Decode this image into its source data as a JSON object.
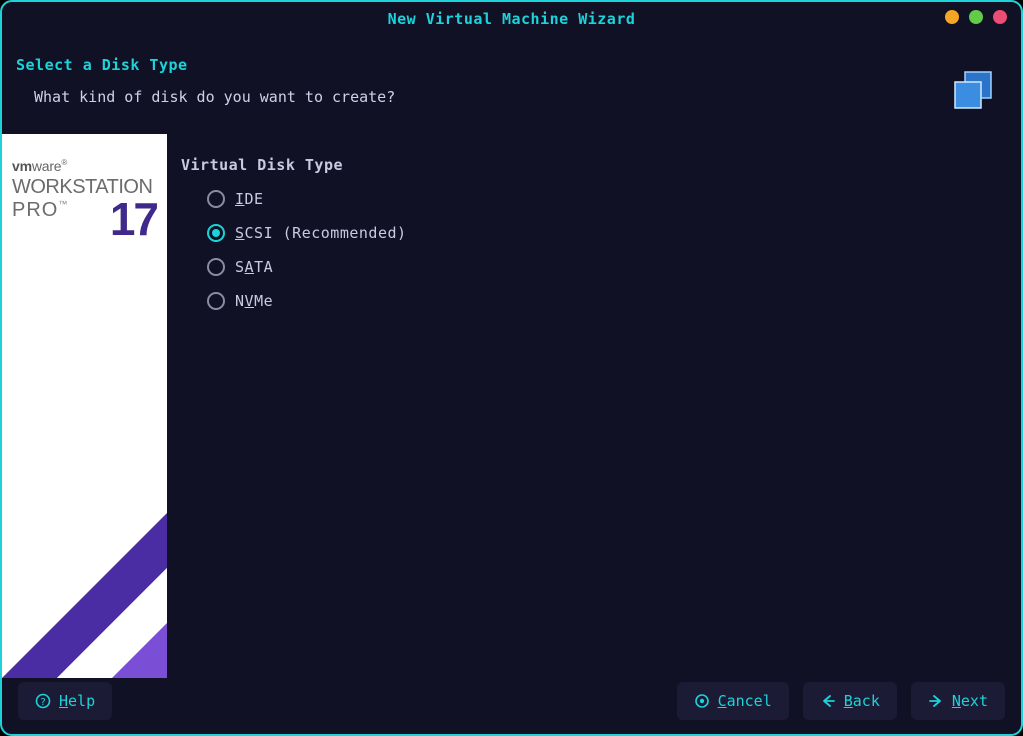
{
  "window": {
    "title": "New Virtual Machine Wizard"
  },
  "header": {
    "title": "Select a Disk Type",
    "subtitle": "What kind of disk do you want to create?"
  },
  "sidebar": {
    "brand_top": "vmware",
    "brand_mid": "WORKSTATION",
    "brand_pro": "PRO",
    "brand_version": "17"
  },
  "main": {
    "group_title": "Virtual Disk Type",
    "options": [
      {
        "id": "ide",
        "pre": "",
        "mn": "I",
        "rest": "DE",
        "selected": false
      },
      {
        "id": "scsi",
        "pre": "",
        "mn": "S",
        "rest": "CSI (Recommended)",
        "selected": true
      },
      {
        "id": "sata",
        "pre": "S",
        "mn": "A",
        "rest": "TA",
        "selected": false
      },
      {
        "id": "nvme",
        "pre": "N",
        "mn": "V",
        "rest": "Me",
        "selected": false
      }
    ]
  },
  "footer": {
    "help": {
      "mn": "H",
      "rest": "elp"
    },
    "cancel": {
      "mn": "C",
      "rest": "ancel"
    },
    "back": {
      "mn": "B",
      "rest": "ack"
    },
    "next": {
      "mn": "N",
      "rest": "ext"
    }
  },
  "colors": {
    "accent": "#1bd3d8",
    "brand_purple": "#3f2a8c"
  }
}
